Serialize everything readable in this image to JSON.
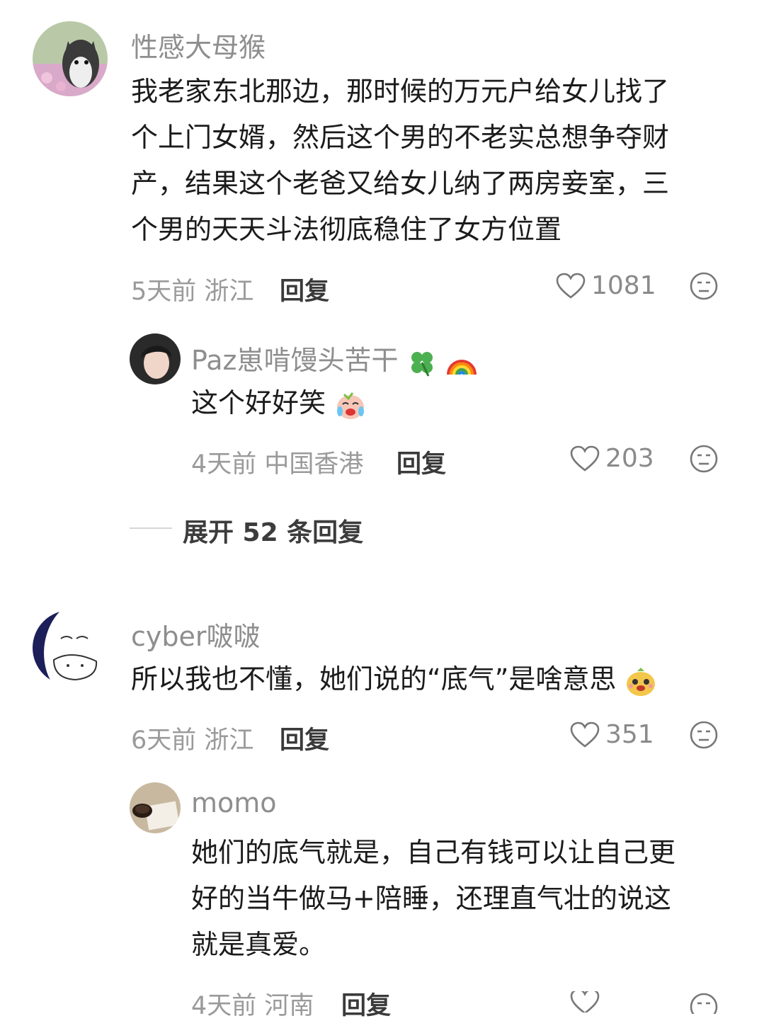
{
  "comments": [
    {
      "username": "性感大母猴",
      "text_lines": [
        "我老家东北那边，那时候的万元户给女儿找了",
        "个上门女婿，然后这个男的不老实总想争夺财",
        "产，结果这个老爸又给女儿纳了两房妾室，三",
        "个男的天天斗法彻底稳住了女方位置"
      ],
      "time": "5天前",
      "location": "浙江",
      "reply_label": "回复",
      "likes": "1081",
      "avatar_icon": "husky-dog-avatar"
    },
    {
      "username": "Paz崽啃馒头苦干",
      "username_emojis": [
        "four-leaf-clover-emoji",
        "rainbow-emoji"
      ],
      "text": "这个好好笑",
      "text_emoji": "laugh-cry-emoji",
      "time": "4天前",
      "location": "中国香港",
      "reply_label": "回复",
      "likes": "203",
      "avatar_icon": "person-avatar"
    },
    {
      "expand_label": "展开 52 条回复"
    },
    {
      "username": "cyber啵啵",
      "text": "所以我也不懂，她们说的“底气”是啥意思",
      "text_emoji": "cute-face-emoji",
      "time": "6天前",
      "location": "浙江",
      "reply_label": "回复",
      "likes": "351",
      "avatar_icon": "cat-sketch-avatar"
    },
    {
      "username": "momo",
      "text_lines": [
        "她们的底气就是，自己有钱可以让自己更",
        "好的当牛做马+陪睡，还理直气壮的说这",
        "就是真爱。"
      ],
      "time": "4天前",
      "location": "河南",
      "reply_label": "回复",
      "avatar_icon": "coffee-book-avatar"
    }
  ],
  "colors": {
    "username": "#8e8e8e",
    "meta": "#9a9a9a",
    "text": "#1b1b1b",
    "accent_like": "#8a8a8a"
  }
}
